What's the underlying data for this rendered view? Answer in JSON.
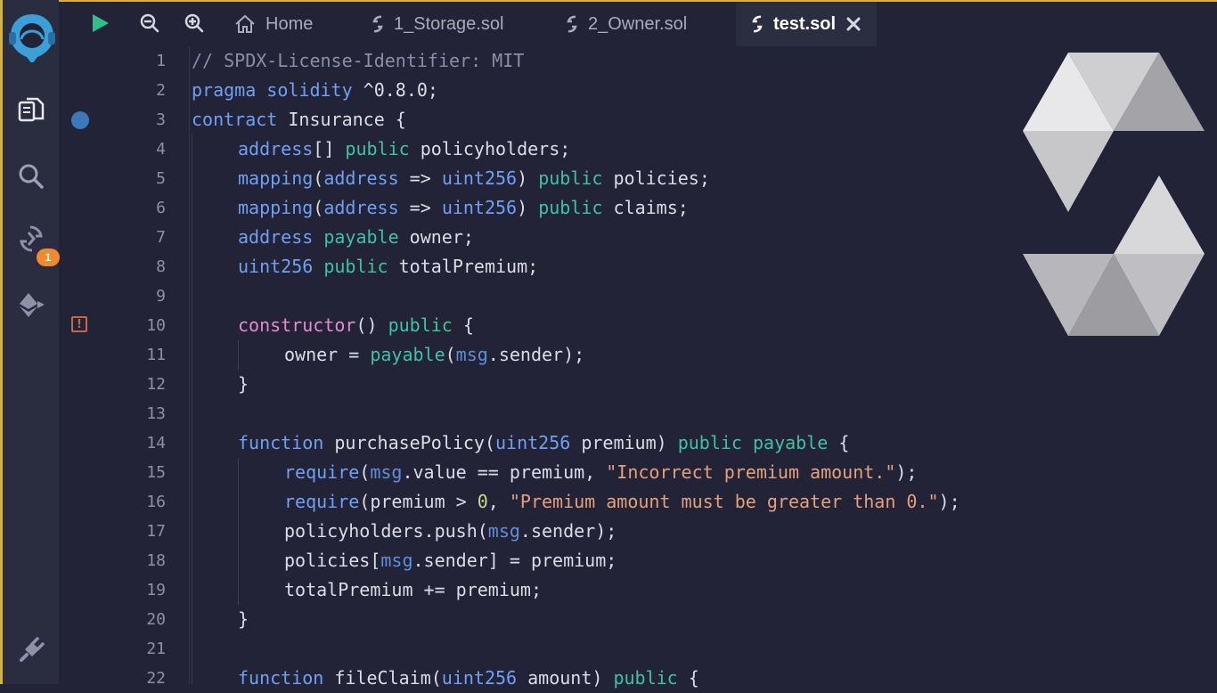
{
  "tabs": [
    {
      "label": "Home",
      "icon": "home-icon"
    },
    {
      "label": "1_Storage.sol",
      "icon": "solidity-file-icon"
    },
    {
      "label": "2_Owner.sol",
      "icon": "solidity-file-icon"
    },
    {
      "label": "test.sol",
      "icon": "solidity-file-icon",
      "active": true
    }
  ],
  "sidebar": {
    "icons": [
      "remix-logo-icon",
      "file-explorer-icon",
      "search-icon",
      "solidity-compiler-icon",
      "deploy-run-icon",
      "plugin-manager-icon"
    ],
    "compiler_badge": "1"
  },
  "toolbar": {
    "icons": [
      "run-icon",
      "zoom-out-icon",
      "zoom-in-icon"
    ]
  },
  "editor": {
    "line_numbers": [
      "1",
      "2",
      "3",
      "4",
      "5",
      "6",
      "7",
      "8",
      "9",
      "10",
      "11",
      "12",
      "13",
      "14",
      "15",
      "16",
      "17",
      "18",
      "19",
      "20",
      "21",
      "22"
    ],
    "code": {
      "l1": "// SPDX-License-Identifier: MIT",
      "l2_a": "pragma solidity",
      "l2_b": " ^0.8.0;",
      "l3_a": "contract",
      "l3_b": " Insurance {",
      "l4_a": "address",
      "l4_b": "[] ",
      "l4_c": "public",
      "l4_d": " policyholders;",
      "l5_a": "mapping",
      "l5_b": "(",
      "l5_c": "address",
      "l5_d": " => ",
      "l5_e": "uint256",
      "l5_f": ") ",
      "l5_g": "public",
      "l5_h": " policies;",
      "l6_a": "mapping",
      "l6_b": "(",
      "l6_c": "address",
      "l6_d": " => ",
      "l6_e": "uint256",
      "l6_f": ") ",
      "l6_g": "public",
      "l6_h": " claims;",
      "l7_a": "address",
      "l7_b": " ",
      "l7_c": "payable",
      "l7_d": " owner;",
      "l8_a": "uint256",
      "l8_b": " ",
      "l8_c": "public",
      "l8_d": " totalPremium;",
      "l10_a": "constructor",
      "l10_b": "() ",
      "l10_c": "public",
      "l10_d": " {",
      "l11_a": "owner = ",
      "l11_b": "payable",
      "l11_c": "(",
      "l11_d": "msg",
      "l11_e": ".sender);",
      "l12": "}",
      "l14_a": "function",
      "l14_b": " purchasePolicy(",
      "l14_c": "uint256",
      "l14_d": " premium) ",
      "l14_e": "public",
      "l14_f": " ",
      "l14_g": "payable",
      "l14_h": " {",
      "l15_a": "require",
      "l15_b": "(",
      "l15_c": "msg",
      "l15_d": ".value == premium, ",
      "l15_e": "\"Incorrect premium amount.\"",
      "l15_f": ");",
      "l16_a": "require",
      "l16_b": "(premium > ",
      "l16_c": "0",
      "l16_d": ", ",
      "l16_e": "\"Premium amount must be greater than 0.\"",
      "l16_f": ");",
      "l17_a": "policyholders.push(",
      "l17_b": "msg",
      "l17_c": ".sender);",
      "l18_a": "policies[",
      "l18_b": "msg",
      "l18_c": ".sender] = premium;",
      "l19": "totalPremium += premium;",
      "l20": "}",
      "l22_a": "function",
      "l22_b": " fileClaim(",
      "l22_c": "uint256",
      "l22_d": " amount) ",
      "l22_e": "public",
      "l22_f": " {"
    }
  },
  "colors": {
    "background": "#222336",
    "sidebar": "#2a2c3f",
    "accent": "#d6b43a",
    "keyword": "#6fa0f2",
    "modifier": "#3ec2a4",
    "string": "#e5a07a",
    "badge": "#f08a2c"
  }
}
